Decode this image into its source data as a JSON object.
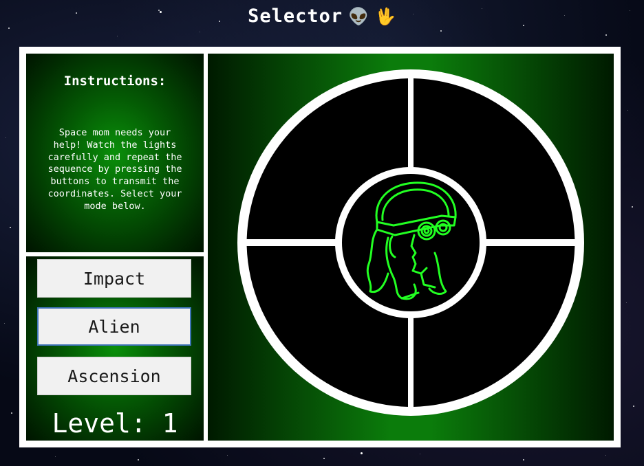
{
  "title": "Selector",
  "title_icons": [
    "alien-icon",
    "vulcan-salute-icon"
  ],
  "instructions": {
    "heading": "Instructions:",
    "body": "Space mom needs your help! Watch the lights carefully and repeat the sequence by pressing the buttons to transmit the coordinates. Select your mode below."
  },
  "modes": [
    {
      "label": "Impact",
      "selected": false
    },
    {
      "label": "Alien",
      "selected": true
    },
    {
      "label": "Ascension",
      "selected": false
    }
  ],
  "level_text": "Level: 1",
  "game_buttons": [
    "top-left",
    "top-right",
    "bottom-left",
    "bottom-right"
  ],
  "center_icon": "space-mom-icon",
  "colors": {
    "panel_green": "#0a8f0a",
    "icon_green": "#22ff22",
    "selected_border": "#3f74b8",
    "frame": "#ffffff",
    "quadrant": "#000000"
  }
}
